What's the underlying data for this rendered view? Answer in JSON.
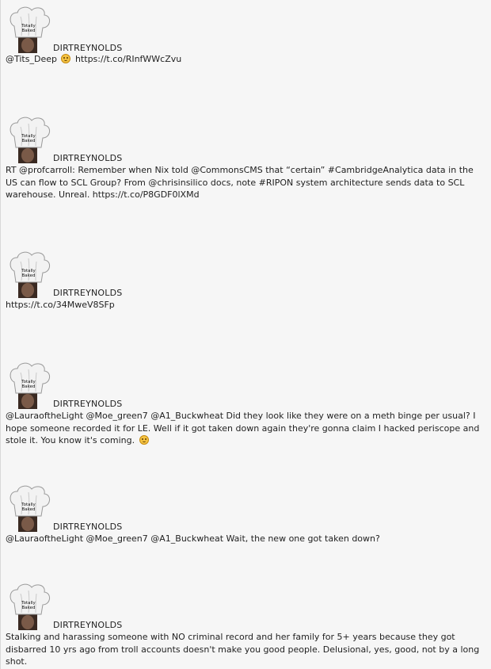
{
  "avatar": {
    "icon": "chef-hat-avatar-icon",
    "hat_text_line1": "Totally",
    "hat_text_line2": "Baked"
  },
  "tweets": [
    {
      "username": "DIRTREYNOLDS",
      "text_before": "@Tits_Deep ",
      "emoji": "upside-down-face-emoji-icon",
      "text_after": " https://t.co/RInfWWcZvu"
    },
    {
      "username": "DIRTREYNOLDS",
      "text": "RT @profcarroll: Remember when Nix told @CommonsCMS that “certain” #CambridgeAnalytica data in the US can flow to SCL Group? From @chrisinsilico docs, note #RIPON system architecture sends data to SCL warehouse. Unreal. https://t.co/P8GDF0lXMd"
    },
    {
      "username": "DIRTREYNOLDS",
      "text": "https://t.co/34MweV8SFp"
    },
    {
      "username": "DIRTREYNOLDS",
      "text_before": "@LauraoftheLight @Moe_green7 @A1_Buckwheat Did they look like they were on a meth binge per usual? I hope someone recorded it for LE. Well if it got taken down again they're gonna claim I hacked periscope and stole it. You know it's coming. ",
      "emoji": "smirking-face-emoji-icon",
      "text_after": ""
    },
    {
      "username": "DIRTREYNOLDS",
      "text": "@LauraoftheLight @Moe_green7 @A1_Buckwheat Wait, the new one got taken down?"
    },
    {
      "username": "DIRTREYNOLDS",
      "text": "Stalking and harassing someone with NO criminal record and her family for 5+ years because they got disbarred 10 yrs ago from troll accounts doesn't make you good people. Delusional, yes, good, not by a long shot."
    }
  ]
}
